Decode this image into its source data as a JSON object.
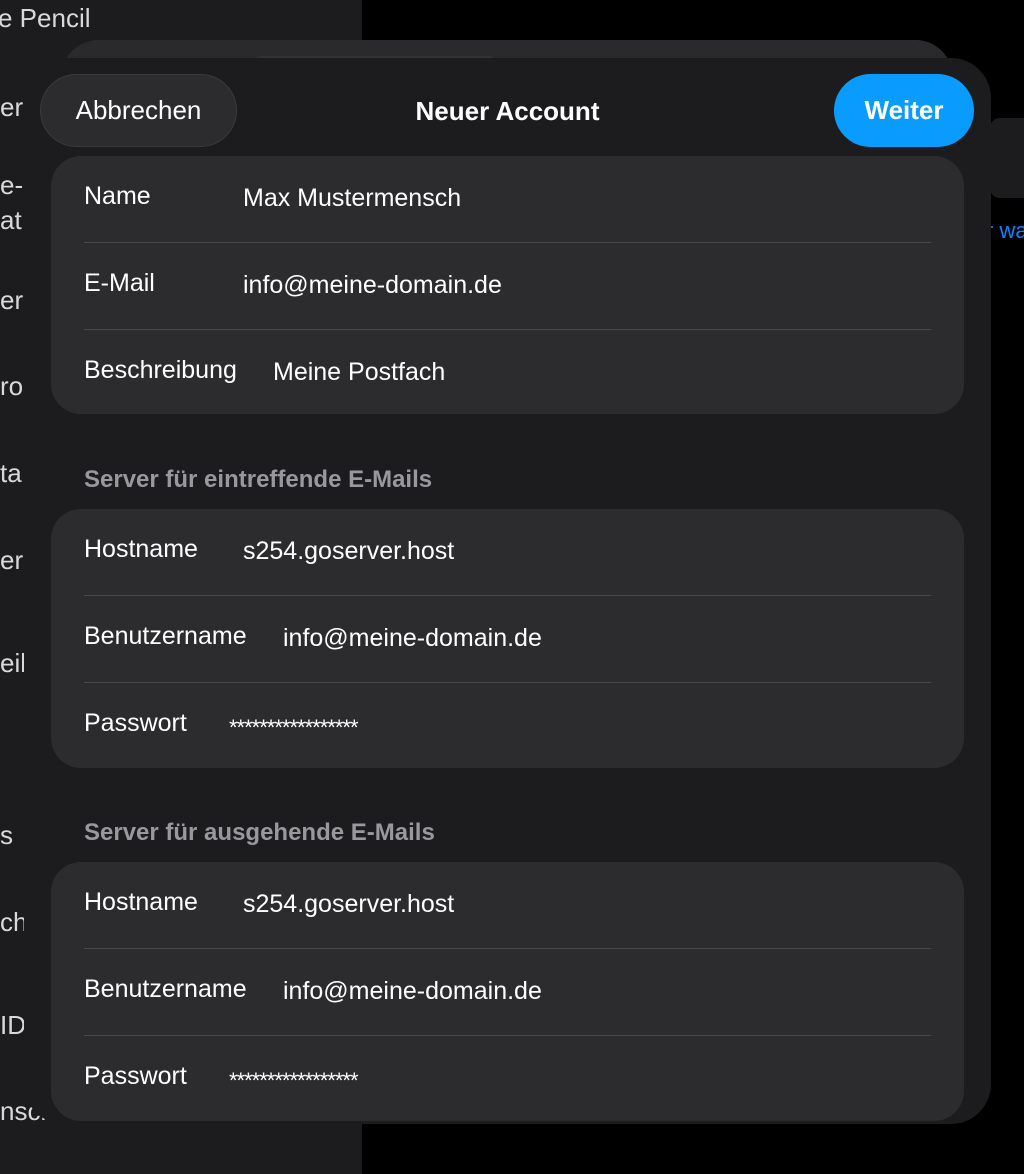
{
  "background": {
    "sidebar_items": [
      "e Pencil",
      "erg",
      "e-",
      "at",
      "era",
      "ro",
      "ta",
      "er",
      "eilu",
      "s",
      "ch",
      "ID",
      "nsch"
    ],
    "right_link": "r wa"
  },
  "nav": {
    "cancel_label": "Abbrechen",
    "title": "Neuer Account",
    "next_label": "Weiter"
  },
  "account": {
    "name_label": "Name",
    "name_value": "Max Mustermensch",
    "email_label": "E-Mail",
    "email_value": "info@meine-domain.de",
    "description_label": "Beschreibung",
    "description_value": "Meine Postfach"
  },
  "incoming": {
    "header": "Server für eintreffende E-Mails",
    "hostname_label": "Hostname",
    "hostname_value": "s254.goserver.host",
    "username_label": "Benutzername",
    "username_value": "info@meine-domain.de",
    "password_label": "Passwort",
    "password_value": "*****************"
  },
  "outgoing": {
    "header": "Server für ausgehende E-Mails",
    "hostname_label": "Hostname",
    "hostname_value": "s254.goserver.host",
    "username_label": "Benutzername",
    "username_value": "info@meine-domain.de",
    "password_label": "Passwort",
    "password_value": "*****************"
  },
  "colors": {
    "accent": "#0a9bff",
    "sheet_background": "#1c1c1e",
    "group_background": "#2c2c2e",
    "section_header": "#98989d"
  }
}
